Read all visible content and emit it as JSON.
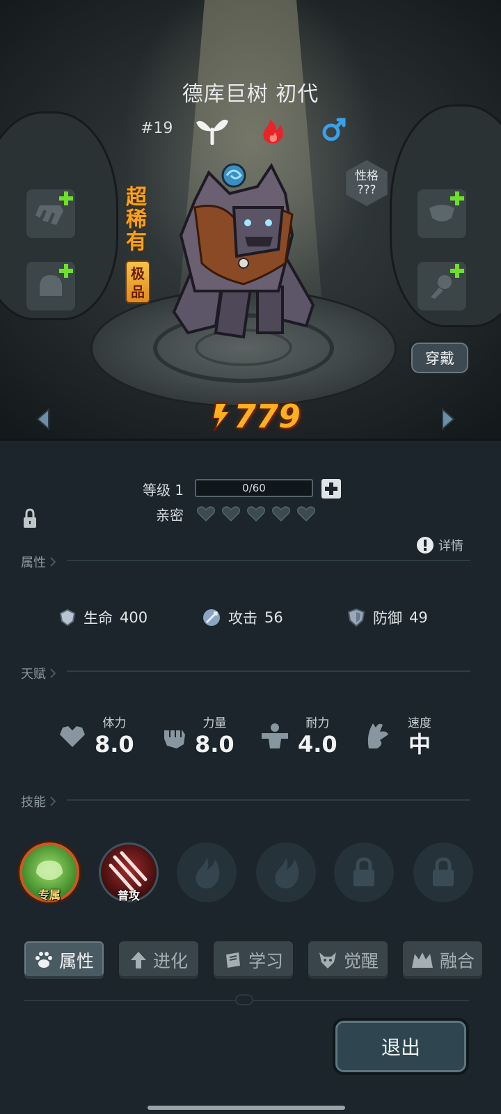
{
  "monster": {
    "name": "德库巨树 初代",
    "index": "#19",
    "rarity": "超稀有",
    "quality": "极品",
    "personality_label": "性格",
    "personality_value": "???",
    "power": "779",
    "type_icons": [
      "sprout-icon",
      "fire-icon",
      "male-icon"
    ]
  },
  "actions": {
    "wear": "穿戴",
    "exit": "退出"
  },
  "level": {
    "label": "等级 1",
    "progress_text": "0/60",
    "progress": 0,
    "intimacy_label": "亲密",
    "intimacy_hearts_filled": 0,
    "intimacy_hearts_total": 5
  },
  "sections": {
    "attributes": "属性",
    "talent": "天赋",
    "skills": "技能",
    "details": "详情"
  },
  "stats": [
    {
      "icon": "heart-shield-icon",
      "label": "生命",
      "value": "400"
    },
    {
      "icon": "sword-icon",
      "label": "攻击",
      "value": "56"
    },
    {
      "icon": "shield-icon",
      "label": "防御",
      "value": "49"
    }
  ],
  "talents": [
    {
      "icon": "heart-icon",
      "label": "体力",
      "value": "8.0"
    },
    {
      "icon": "fist-icon",
      "label": "力量",
      "value": "8.0"
    },
    {
      "icon": "muscle-icon",
      "label": "耐力",
      "value": "4.0"
    },
    {
      "icon": "wing-icon",
      "label": "速度",
      "value": "中"
    }
  ],
  "skills": [
    {
      "tag": "专属",
      "state": "exclusive"
    },
    {
      "tag": "普攻",
      "state": "normal"
    },
    {
      "tag": "",
      "state": "empty"
    },
    {
      "tag": "",
      "state": "empty"
    },
    {
      "tag": "",
      "state": "locked"
    },
    {
      "tag": "",
      "state": "locked"
    }
  ],
  "tabs": [
    {
      "label": "属性",
      "icon": "paw-icon",
      "active": true
    },
    {
      "label": "进化",
      "icon": "arrow-up-icon",
      "active": false
    },
    {
      "label": "学习",
      "icon": "book-icon",
      "active": false
    },
    {
      "label": "觉醒",
      "icon": "demon-icon",
      "active": false
    },
    {
      "label": "融合",
      "icon": "fusion-icon",
      "active": false
    }
  ],
  "colors": {
    "power": "#ffb01e",
    "rarity": "#f7a21a",
    "plus_green": "#6ee02a"
  }
}
